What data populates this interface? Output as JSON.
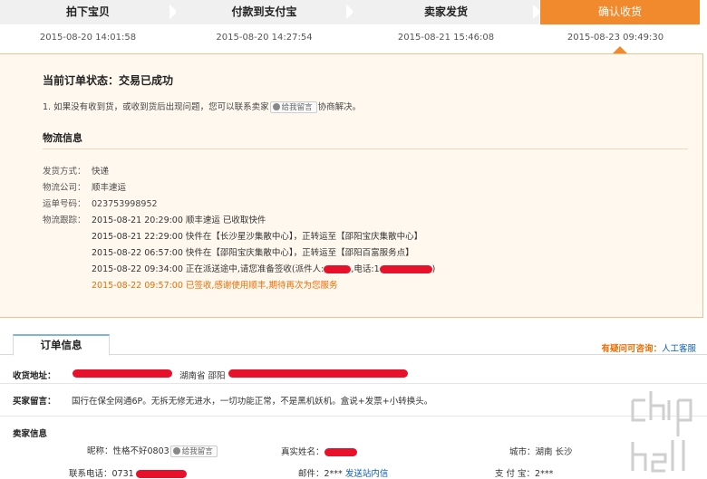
{
  "steps": [
    {
      "label": "拍下宝贝",
      "time": "2015-08-20 14:01:58"
    },
    {
      "label": "付款到支付宝",
      "time": "2015-08-20 14:27:54"
    },
    {
      "label": "卖家发货",
      "time": "2015-08-21 15:46:08"
    },
    {
      "label": "确认收货",
      "time": "2015-08-23 09:49:30"
    }
  ],
  "order_status": "当前订单状态：交易已成功",
  "notice": {
    "before": "1. 如果没有收到货，或收到货后出现问题，您可以联系卖家",
    "button": "给我留言",
    "after": "协商解决。"
  },
  "logistics": {
    "title": "物流信息",
    "method_label": "发货方式：",
    "method_value": "快递",
    "company_label": "物流公司：",
    "company_value": "顺丰速运",
    "tracking_label": "运单号码：",
    "tracking_value": "023753998952",
    "trace_label": "物流跟踪：",
    "events": [
      "2015-08-21 20:29:00 顺丰速运 已收取快件",
      "2015-08-21 22:29:00 快件在【长沙星沙集散中心】，正转运至【邵阳宝庆集散中心】",
      "2015-08-22 06:57:00 快件在【邵阳宝庆集散中心】，正转运至【邵阳百富服务点】",
      "2015-08-22 09:34:00 正在派送途中,请您准备签收(派件人:",
      "2015-08-22 09:57:00 已签收,感谢使用顺丰,期待再次为您服务"
    ],
    "event4_phone_label": ",电话:1",
    "event4_close": ")"
  },
  "order_tab": "订单信息",
  "help": {
    "question": "有疑问可咨询：",
    "link": "人工客服"
  },
  "address": {
    "label": "收货地址：",
    "value": "湖南省 邵阳"
  },
  "buyer_message": {
    "label": "买家留言：",
    "value": "国行在保全网通6P。无拆无修无进水，一切功能正常，不是黑机妖机。盒说+发票+小转换头。"
  },
  "seller": {
    "title": "卖家信息",
    "nickname_label": "昵称：",
    "nickname_value": "性格不好0803",
    "message_button": "给我留言",
    "realname_label": "真实姓名：",
    "city_label": "城市：",
    "city_value": "湖南 长沙",
    "phone_label": "联系电话：",
    "phone_value": "0731",
    "email_label": "邮件：",
    "email_value": "2***",
    "email_link": "发送站内信",
    "alipay_label": "支 付 宝：",
    "alipay_value": "2***"
  },
  "watermark": {
    "text": "chip hell",
    "url": "www.chiphell.com"
  },
  "colors": {
    "accent": "#f08a2c",
    "link": "#0a5dba",
    "highlight": "#f06c00",
    "redaction": "#e8112b"
  }
}
